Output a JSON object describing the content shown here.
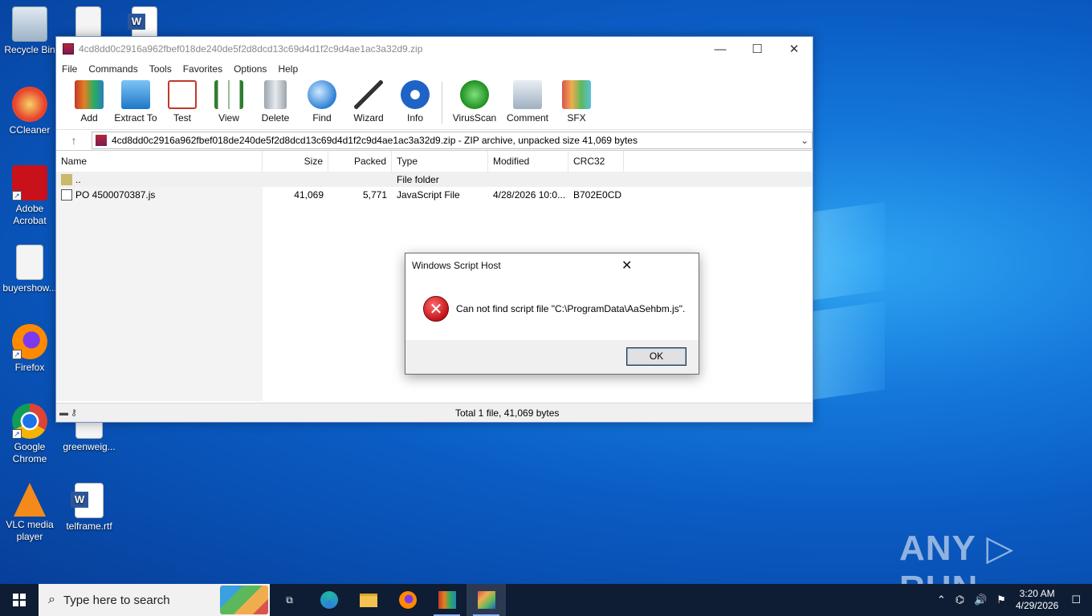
{
  "desktop": {
    "icons": [
      {
        "label": "Recycle Bin",
        "icon": "recycle-bin-icon"
      },
      {
        "label": "CCleaner",
        "icon": "ccleaner-icon"
      },
      {
        "label": "Adobe Acrobat",
        "icon": "adobe-acrobat-icon"
      },
      {
        "label": "buyershow...",
        "icon": "image-file-icon"
      },
      {
        "label": "Firefox",
        "icon": "firefox-icon"
      },
      {
        "label": "Google Chrome",
        "icon": "chrome-icon"
      },
      {
        "label": "VLC media player",
        "icon": "vlc-icon"
      },
      {
        "label": "greenweig...",
        "icon": "winrar-file-icon"
      },
      {
        "label": "telframe.rtf",
        "icon": "word-document-icon"
      }
    ],
    "watermark": "ANY ▷ RUN"
  },
  "winrar": {
    "title": "4cd8dd0c2916a962fbef018de240de5f2d8dcd13c69d4d1f2c9d4ae1ac3a32d9.zip",
    "menu": [
      "File",
      "Commands",
      "Tools",
      "Favorites",
      "Options",
      "Help"
    ],
    "toolbar": [
      "Add",
      "Extract To",
      "Test",
      "View",
      "Delete",
      "Find",
      "Wizard",
      "Info",
      "VirusScan",
      "Comment",
      "SFX"
    ],
    "address": "4cd8dd0c2916a962fbef018de240de5f2d8dcd13c69d4d1f2c9d4ae1ac3a32d9.zip - ZIP archive, unpacked size 41,069 bytes",
    "columns": [
      "Name",
      "Size",
      "Packed",
      "Type",
      "Modified",
      "CRC32"
    ],
    "rows": [
      {
        "name": "..",
        "size": "",
        "packed": "",
        "type": "File folder",
        "modified": "",
        "crc": ""
      },
      {
        "name": "PO 4500070387.js",
        "size": "41,069",
        "packed": "5,771",
        "type": "JavaScript File",
        "modified": "4/28/2026 10:0...",
        "crc": "B702E0CD"
      }
    ],
    "status": "Total 1 file, 41,069 bytes"
  },
  "dialog": {
    "title": "Windows Script Host",
    "message": "Can not find script file \"C:\\ProgramData\\AaSehbm.js\".",
    "ok_label": "OK"
  },
  "taskbar": {
    "search_placeholder": "Type here to search",
    "time": "3:20 AM",
    "date": "4/29/2026"
  },
  "colors": {
    "desktop_bg": "#0a5cc4",
    "taskbar_bg": "#0e1d33",
    "error_red": "#c0141a"
  }
}
